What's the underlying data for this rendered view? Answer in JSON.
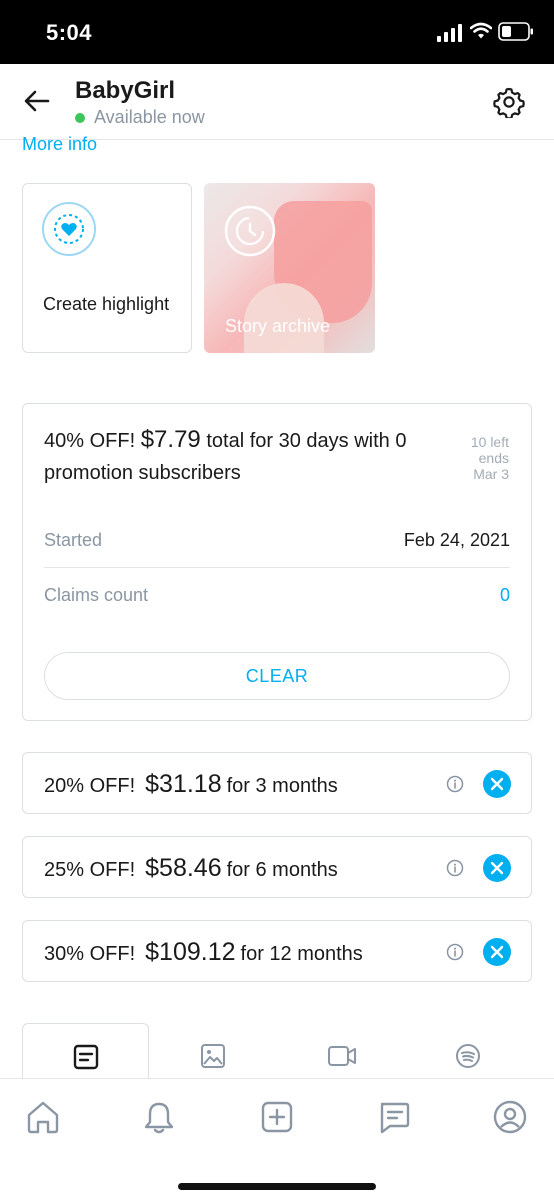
{
  "status_bar": {
    "time": "5:04"
  },
  "header": {
    "title": "BabyGirl",
    "status_text": "Available now"
  },
  "more_info": "More info",
  "highlights": {
    "create_label": "Create highlight",
    "archive_label": "Story archive"
  },
  "promotion": {
    "discount": "40% OFF!",
    "price": "$7.79",
    "description": "total for 30 days with 0 promotion subscribers",
    "left": "10 left",
    "ends_label": "ends",
    "ends_date": "Mar 3",
    "started_label": "Started",
    "started_value": "Feb 24, 2021",
    "claims_label": "Claims count",
    "claims_value": "0",
    "clear_label": "CLEAR"
  },
  "discounts": [
    {
      "percent": "20% OFF!",
      "price": "$31.18",
      "period": "for 3 months"
    },
    {
      "percent": "25% OFF!",
      "price": "$58.46",
      "period": "for 6 months"
    },
    {
      "percent": "30% OFF!",
      "price": "$109.12",
      "period": "for 12 months"
    }
  ],
  "colors": {
    "accent": "#00aff0",
    "online": "#3cc55a",
    "muted": "#8a96a3",
    "border": "#dcdfe3"
  },
  "content_tabs": [
    "posts-icon",
    "photos-icon",
    "videos-icon",
    "audio-icon"
  ],
  "bottom_nav": [
    "home-icon",
    "bell-icon",
    "add-icon",
    "messages-icon",
    "profile-icon"
  ]
}
